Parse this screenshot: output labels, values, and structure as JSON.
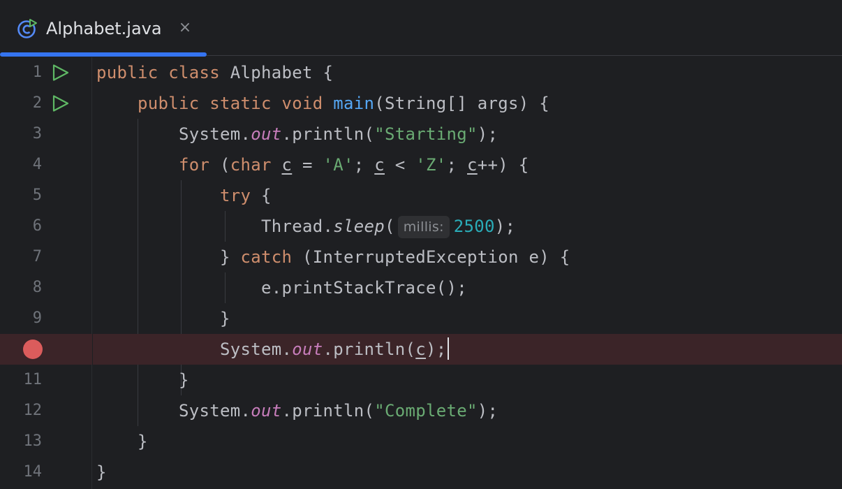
{
  "tab": {
    "label": "Alphabet.java",
    "close_glyph": "×"
  },
  "line_numbers": [
    "1",
    "2",
    "3",
    "4",
    "5",
    "6",
    "7",
    "8",
    "9",
    "10",
    "11",
    "12",
    "13",
    "14"
  ],
  "breakpoint_line": "10",
  "code": {
    "l1": {
      "kw1": "public",
      "kw2": "class",
      "name": "Alphabet",
      "brace": "{"
    },
    "l2": {
      "kw1": "public",
      "kw2": "static",
      "kw3": "void",
      "fn": "main",
      "params": "(String[] args) {"
    },
    "l3": {
      "recv": "System.",
      "field": "out",
      "call": ".println(",
      "str": "\"Starting\"",
      "end": ");"
    },
    "l4": {
      "kw": "for",
      "open": "(",
      "kw2": "char",
      "var1": "c",
      "eq": " = ",
      "str1": "'A'",
      "semi1": "; ",
      "var2": "c",
      "lt": " < ",
      "str2": "'Z'",
      "semi2": "; ",
      "var3": "c",
      "inc": "++) {"
    },
    "l5": {
      "kw": "try",
      "brace": "{"
    },
    "l6": {
      "recv": "Thread.",
      "method": "sleep",
      "open": "(",
      "hint": "millis:",
      "num": "2500",
      "end": ");"
    },
    "l7": {
      "close": "}",
      "kw": "catch",
      "params": "(InterruptedException e) {"
    },
    "l8": {
      "text": "e.printStackTrace();"
    },
    "l9": {
      "text": "}"
    },
    "l10": {
      "recv": "System.",
      "field": "out",
      "call": ".println(",
      "var": "c",
      "end": ");"
    },
    "l11": {
      "text": "}"
    },
    "l12": {
      "recv": "System.",
      "field": "out",
      "call": ".println(",
      "str": "\"Complete\"",
      "end": ");"
    },
    "l13": {
      "text": "}"
    },
    "l14": {
      "text": "}"
    }
  },
  "colors": {
    "keyword": "#cf8e6d",
    "function": "#56a8f5",
    "string": "#6aab73",
    "number": "#2aacb8",
    "field": "#c77dbb",
    "breakpoint": "#db5c5c",
    "accent": "#3574f0",
    "background": "#1e1f22"
  },
  "icons": {
    "tab": "java-class-run-icon",
    "run": "run-play-icon",
    "breakpoint": "breakpoint-dot-icon",
    "close": "close-icon"
  }
}
